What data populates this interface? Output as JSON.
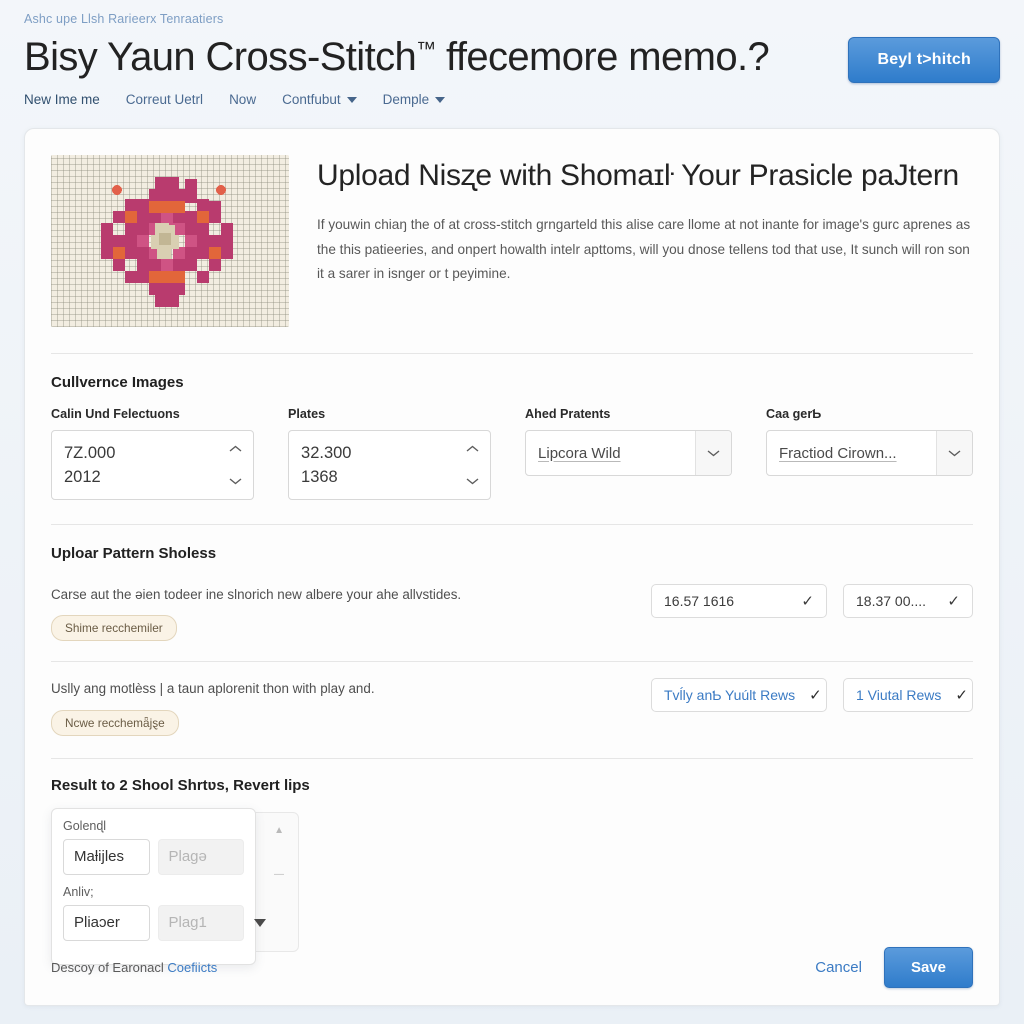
{
  "header": {
    "breadcrumb": "Ashc upe Llsh Rarieerx Tenraatiers",
    "title": "Bisy Yaun Cross-Stitch",
    "title_tm": "™",
    "title_rest": " ffecemore memo.?",
    "cta_label": "Beyl t>hitch",
    "nav": [
      {
        "label": "New Ime me",
        "caret": false
      },
      {
        "label": "Correut Uetrl",
        "caret": false
      },
      {
        "label": "Now",
        "caret": false
      },
      {
        "label": "Contfubut",
        "caret": true
      },
      {
        "label": "Demple",
        "caret": true
      }
    ]
  },
  "hero": {
    "image_alt": "cross-stitch-star-flower-sample",
    "title": "Upload Nisʐe with Shomaɪŀ Your Prasicle paJtern",
    "body": "If youwin chiaŋ the of at cross-stitch grngarteld this alise care llome at not inante for image's gurc aprenes as the this patieeries, and onpert howalth intelr apttoms, will you dnose tellens tod that use, It sunch will ron son it a sarer in isnger or t peyimine."
  },
  "images_section": {
    "title": "Cullvernce Images",
    "fields": [
      {
        "label": "Calin Und Felectuons",
        "type": "spinner",
        "value_top": "7Z.000",
        "value_bottom": "2012"
      },
      {
        "label": "Plates",
        "type": "spinner",
        "value_top": "32.300",
        "value_bottom": "1368"
      },
      {
        "label": "Ahed Pratents",
        "type": "select",
        "value": "Lipcora Wild"
      },
      {
        "label": "Caa ɡerƄ",
        "type": "select",
        "value": "Fractiod Cirown..."
      }
    ]
  },
  "pattern_section": {
    "title": "Uploar Pattern Sholess",
    "rows": [
      {
        "desc": "Carse aut the ǝien todeer ine slnorich new albere your ahe allvstides.",
        "badge": "Shime recchemiler",
        "chips": [
          {
            "label": "16.57 1616",
            "style": "dark",
            "width": "w1"
          },
          {
            "label": "18.37 00....",
            "style": "dark",
            "width": "w2"
          }
        ]
      },
      {
        "desc": "Uslly anɡ motlèss | a taun aplorenit thon with play and.",
        "badge": "Ncwe recchemǟjȿe",
        "chips": [
          {
            "label": "Tvĺly anƄ Yuúlt Rews",
            "style": "blue",
            "width": "w1"
          },
          {
            "label": "1 Viutal Rews",
            "style": "blue",
            "width": "w2"
          }
        ]
      }
    ]
  },
  "result_section": {
    "title": "Result to 2 Shool Shrtʋs, Revert lips",
    "popover": {
      "label_1": "Golenɖl",
      "input_1_value": "Maƚijles",
      "input_1_placeholder": "Plagǝ",
      "label_2": "Anlіv;",
      "input_2_value": "Plіaɔer",
      "input_2_placeholder": "Plag1"
    }
  },
  "footer": {
    "note_prefix": "Descoy of Earonacl ",
    "note_link": "Coefiicts",
    "cancel_label": "Cancel",
    "save_label": "Save"
  },
  "icons": {
    "caret_down": "chevron-down-icon",
    "check": "✓",
    "spinner_up": "chevron-up-icon",
    "spinner_down": "chevron-down-icon"
  },
  "colors": {
    "accent": "#2f7ccb",
    "link": "#3b7bc4",
    "badge_bg": "#faf3e6",
    "badge_border": "#e3d6bd",
    "page_bg": "#eef2f7",
    "card_bg": "#fdfdfd"
  }
}
